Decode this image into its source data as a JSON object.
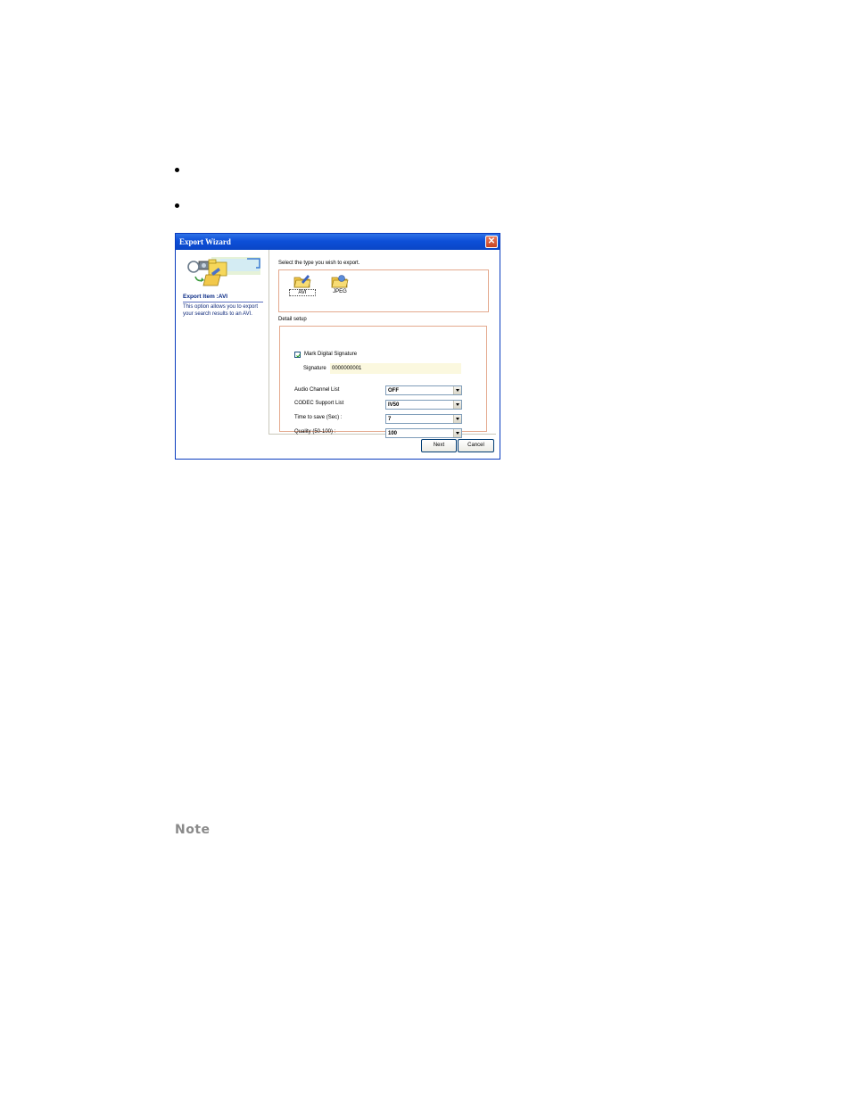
{
  "window": {
    "title": "Export Wizard",
    "close_glyph": "✕"
  },
  "left_pane": {
    "export_item_label": "Export Item :AVI",
    "description": "This option allows you to export your search results to an AVI."
  },
  "export_type": {
    "prompt": "Select the type you wish to export.",
    "options": [
      {
        "label": "AVI",
        "icon": "avi-folder-icon",
        "selected": true
      },
      {
        "label": "JPEG",
        "icon": "jpeg-folder-icon",
        "selected": false
      }
    ]
  },
  "detail_setup": {
    "label": "Detail setup",
    "mark_signature_label": "Mark Digital Signature",
    "mark_signature_checked": true,
    "signature_label": "Signature",
    "signature_value": "0000000001",
    "audio_channel_label": "Audio Channel List",
    "audio_channel_value": "OFF",
    "codec_label": "CODEC Support List",
    "codec_value": "IV50",
    "time_label": "Time to save (Sec) :",
    "time_value": "7",
    "quality_label": "Quality (50-100) :",
    "quality_value": "100"
  },
  "buttons": {
    "next": "Next",
    "cancel": "Cancel"
  },
  "note_label": "Note",
  "colors": {
    "titlebar": "#0d4fd8",
    "group_border": "#e4a98e",
    "signature_field_bg": "#fbf8df"
  }
}
